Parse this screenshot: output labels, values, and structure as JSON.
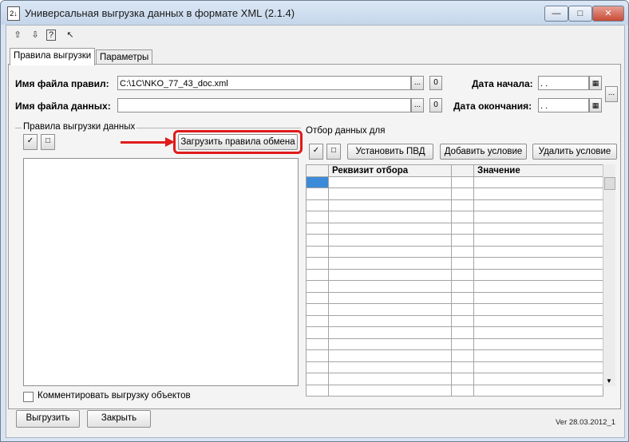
{
  "window": {
    "title": "Универсальная выгрузка данных в формате XML (2.1.4)",
    "icon_label": "2↓",
    "minimize": "—",
    "maximize": "□",
    "close": "✕"
  },
  "toolbar": {
    "icons": [
      "open-icon",
      "save-icon",
      "help-icon",
      "pointer-help-icon"
    ],
    "glyphs": [
      "⇧",
      "⇩",
      "?",
      "↖"
    ]
  },
  "tabs": [
    "Правила выгрузки",
    "Параметры"
  ],
  "form": {
    "rules_file_label": "Имя файла правил:",
    "rules_file_value": "C:\\1C\\NKO_77_43_doc.xml",
    "data_file_label": "Имя файла данных:",
    "data_file_value": "",
    "browse": "...",
    "open": "0",
    "date_start_label": "Дата начала:",
    "date_end_label": "Дата окончания:",
    "date_value": " .  .",
    "period": "..."
  },
  "rules_group": {
    "title": "Правила выгрузки данных",
    "load_button": "Загрузить правила обмена",
    "check_all": "✓",
    "uncheck_all": "□"
  },
  "filter_group": {
    "title": "Отбор данных для",
    "set_pvd": "Установить ПВД",
    "add_condition": "Добавить условие",
    "delete_condition": "Удалить условие",
    "columns": [
      "",
      "Реквизит отбора",
      "",
      "Значение"
    ],
    "row_count": 19
  },
  "comment_checkbox": "Комментировать выгрузку объектов",
  "buttons": {
    "export": "Выгрузить",
    "close": "Закрыть"
  },
  "version": "Ver 28.03.2012_1",
  "colors": {
    "highlight": "#e01b1b",
    "selection": "#3c8bd8"
  }
}
